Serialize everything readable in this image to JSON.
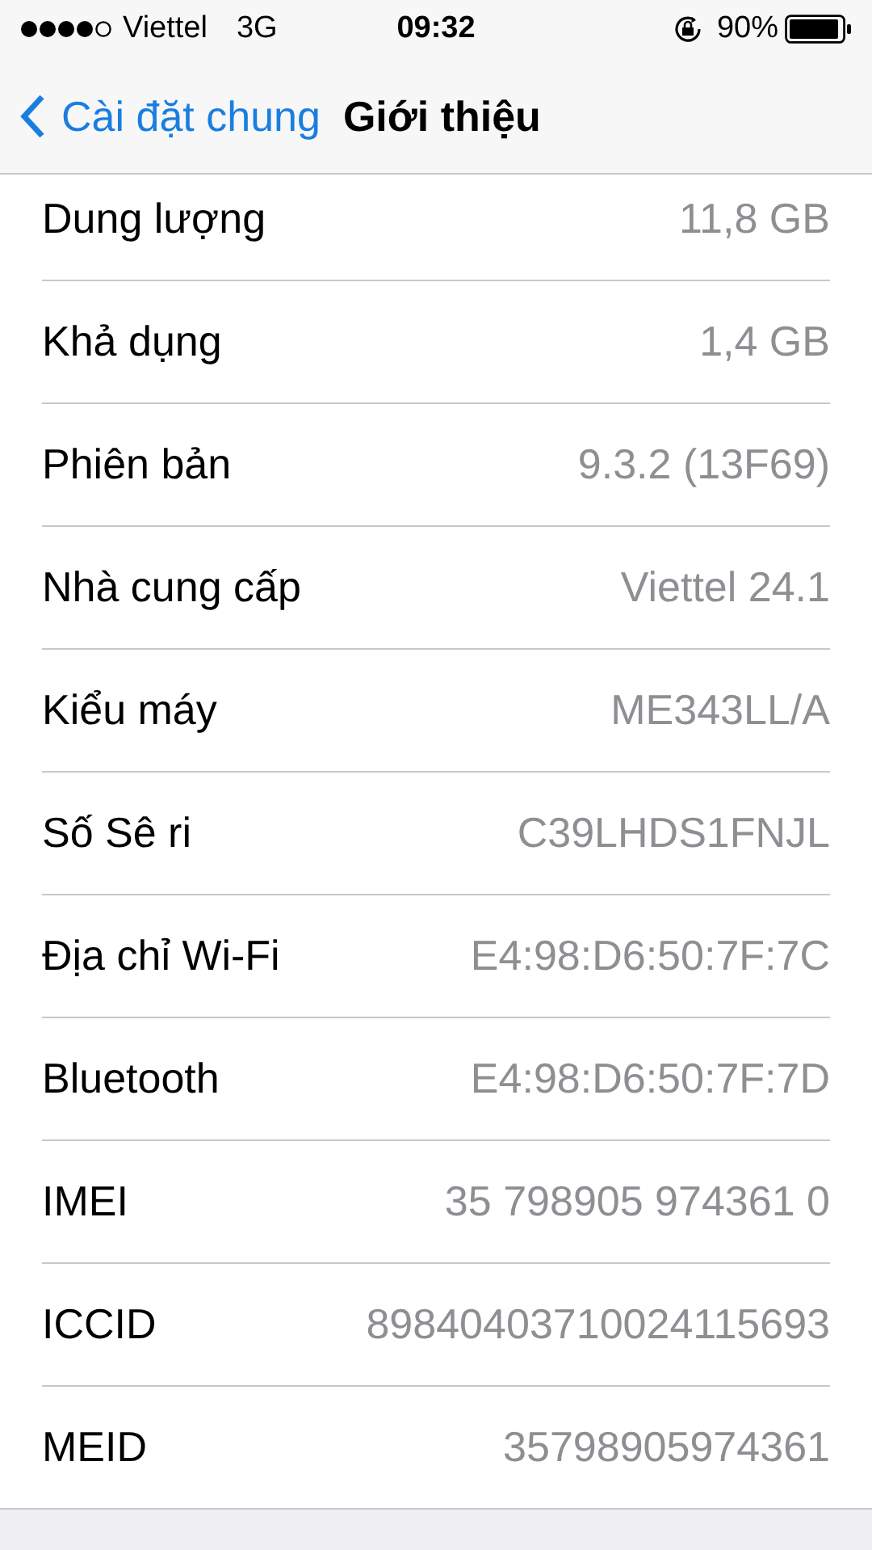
{
  "status_bar": {
    "carrier": "Viettel",
    "network": "3G",
    "time": "09:32",
    "battery": "90%"
  },
  "nav": {
    "back": "Cài đặt chung",
    "title": "Giới thiệu"
  },
  "rows": [
    {
      "label": "Dung lượng",
      "value": "11,8 GB"
    },
    {
      "label": "Khả dụng",
      "value": "1,4 GB"
    },
    {
      "label": "Phiên bản",
      "value": "9.3.2 (13F69)"
    },
    {
      "label": "Nhà cung cấp",
      "value": "Viettel 24.1"
    },
    {
      "label": "Kiểu máy",
      "value": "ME343LL/A"
    },
    {
      "label": "Số Sê ri",
      "value": "C39LHDS1FNJL"
    },
    {
      "label": "Địa chỉ Wi-Fi",
      "value": "E4:98:D6:50:7F:7C"
    },
    {
      "label": "Bluetooth",
      "value": "E4:98:D6:50:7F:7D"
    },
    {
      "label": "IMEI",
      "value": "35 798905 974361 0"
    },
    {
      "label": "ICCID",
      "value": "89840403710024115693"
    },
    {
      "label": "MEID",
      "value": "35798905974361"
    }
  ]
}
